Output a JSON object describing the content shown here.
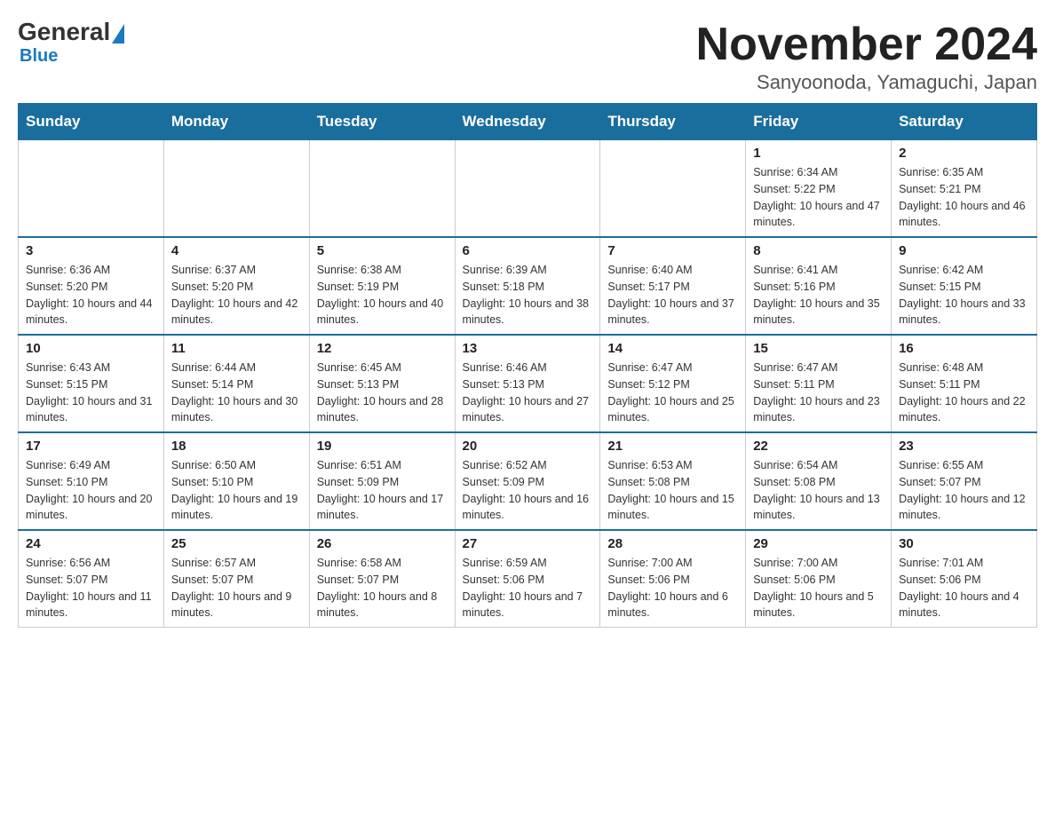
{
  "logo": {
    "general": "General",
    "blue": "Blue"
  },
  "title": "November 2024",
  "subtitle": "Sanyoonoda, Yamaguchi, Japan",
  "days_of_week": [
    "Sunday",
    "Monday",
    "Tuesday",
    "Wednesday",
    "Thursday",
    "Friday",
    "Saturday"
  ],
  "weeks": [
    [
      {
        "day": "",
        "info": ""
      },
      {
        "day": "",
        "info": ""
      },
      {
        "day": "",
        "info": ""
      },
      {
        "day": "",
        "info": ""
      },
      {
        "day": "",
        "info": ""
      },
      {
        "day": "1",
        "info": "Sunrise: 6:34 AM\nSunset: 5:22 PM\nDaylight: 10 hours and 47 minutes."
      },
      {
        "day": "2",
        "info": "Sunrise: 6:35 AM\nSunset: 5:21 PM\nDaylight: 10 hours and 46 minutes."
      }
    ],
    [
      {
        "day": "3",
        "info": "Sunrise: 6:36 AM\nSunset: 5:20 PM\nDaylight: 10 hours and 44 minutes."
      },
      {
        "day": "4",
        "info": "Sunrise: 6:37 AM\nSunset: 5:20 PM\nDaylight: 10 hours and 42 minutes."
      },
      {
        "day": "5",
        "info": "Sunrise: 6:38 AM\nSunset: 5:19 PM\nDaylight: 10 hours and 40 minutes."
      },
      {
        "day": "6",
        "info": "Sunrise: 6:39 AM\nSunset: 5:18 PM\nDaylight: 10 hours and 38 minutes."
      },
      {
        "day": "7",
        "info": "Sunrise: 6:40 AM\nSunset: 5:17 PM\nDaylight: 10 hours and 37 minutes."
      },
      {
        "day": "8",
        "info": "Sunrise: 6:41 AM\nSunset: 5:16 PM\nDaylight: 10 hours and 35 minutes."
      },
      {
        "day": "9",
        "info": "Sunrise: 6:42 AM\nSunset: 5:15 PM\nDaylight: 10 hours and 33 minutes."
      }
    ],
    [
      {
        "day": "10",
        "info": "Sunrise: 6:43 AM\nSunset: 5:15 PM\nDaylight: 10 hours and 31 minutes."
      },
      {
        "day": "11",
        "info": "Sunrise: 6:44 AM\nSunset: 5:14 PM\nDaylight: 10 hours and 30 minutes."
      },
      {
        "day": "12",
        "info": "Sunrise: 6:45 AM\nSunset: 5:13 PM\nDaylight: 10 hours and 28 minutes."
      },
      {
        "day": "13",
        "info": "Sunrise: 6:46 AM\nSunset: 5:13 PM\nDaylight: 10 hours and 27 minutes."
      },
      {
        "day": "14",
        "info": "Sunrise: 6:47 AM\nSunset: 5:12 PM\nDaylight: 10 hours and 25 minutes."
      },
      {
        "day": "15",
        "info": "Sunrise: 6:47 AM\nSunset: 5:11 PM\nDaylight: 10 hours and 23 minutes."
      },
      {
        "day": "16",
        "info": "Sunrise: 6:48 AM\nSunset: 5:11 PM\nDaylight: 10 hours and 22 minutes."
      }
    ],
    [
      {
        "day": "17",
        "info": "Sunrise: 6:49 AM\nSunset: 5:10 PM\nDaylight: 10 hours and 20 minutes."
      },
      {
        "day": "18",
        "info": "Sunrise: 6:50 AM\nSunset: 5:10 PM\nDaylight: 10 hours and 19 minutes."
      },
      {
        "day": "19",
        "info": "Sunrise: 6:51 AM\nSunset: 5:09 PM\nDaylight: 10 hours and 17 minutes."
      },
      {
        "day": "20",
        "info": "Sunrise: 6:52 AM\nSunset: 5:09 PM\nDaylight: 10 hours and 16 minutes."
      },
      {
        "day": "21",
        "info": "Sunrise: 6:53 AM\nSunset: 5:08 PM\nDaylight: 10 hours and 15 minutes."
      },
      {
        "day": "22",
        "info": "Sunrise: 6:54 AM\nSunset: 5:08 PM\nDaylight: 10 hours and 13 minutes."
      },
      {
        "day": "23",
        "info": "Sunrise: 6:55 AM\nSunset: 5:07 PM\nDaylight: 10 hours and 12 minutes."
      }
    ],
    [
      {
        "day": "24",
        "info": "Sunrise: 6:56 AM\nSunset: 5:07 PM\nDaylight: 10 hours and 11 minutes."
      },
      {
        "day": "25",
        "info": "Sunrise: 6:57 AM\nSunset: 5:07 PM\nDaylight: 10 hours and 9 minutes."
      },
      {
        "day": "26",
        "info": "Sunrise: 6:58 AM\nSunset: 5:07 PM\nDaylight: 10 hours and 8 minutes."
      },
      {
        "day": "27",
        "info": "Sunrise: 6:59 AM\nSunset: 5:06 PM\nDaylight: 10 hours and 7 minutes."
      },
      {
        "day": "28",
        "info": "Sunrise: 7:00 AM\nSunset: 5:06 PM\nDaylight: 10 hours and 6 minutes."
      },
      {
        "day": "29",
        "info": "Sunrise: 7:00 AM\nSunset: 5:06 PM\nDaylight: 10 hours and 5 minutes."
      },
      {
        "day": "30",
        "info": "Sunrise: 7:01 AM\nSunset: 5:06 PM\nDaylight: 10 hours and 4 minutes."
      }
    ]
  ]
}
